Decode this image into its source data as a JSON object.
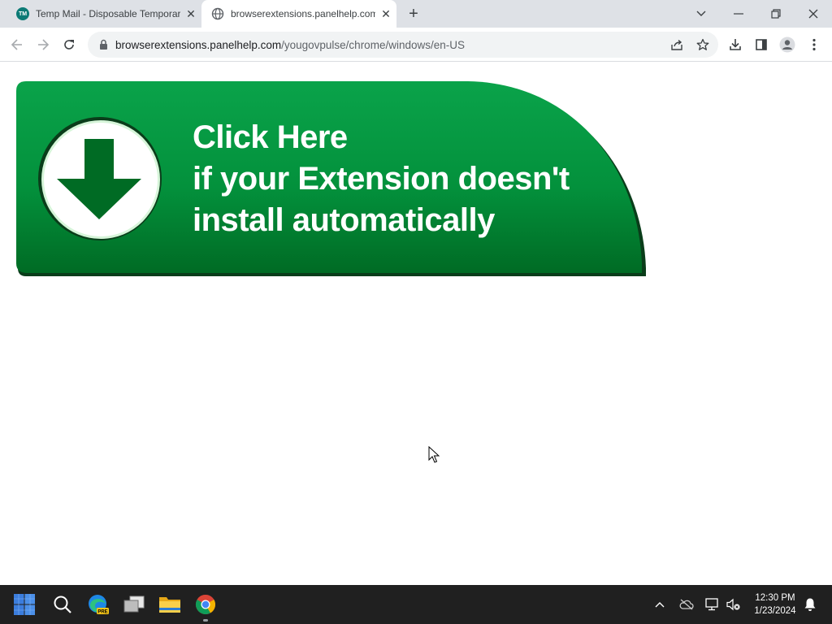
{
  "browser": {
    "tabs": [
      {
        "title": "Temp Mail - Disposable Temporary",
        "favicon": "tempmail-icon",
        "active": false
      },
      {
        "title": "browserextensions.panelhelp.com",
        "favicon": "globe-icon",
        "active": true
      }
    ],
    "address": {
      "host": "browserextensions.panelhelp.com",
      "path": "/yougovpulse/chrome/windows/en-US"
    }
  },
  "page": {
    "banner": {
      "line1": "Click Here",
      "line2": "if your Extension doesn't",
      "line3": "install automatically",
      "colors": {
        "green_top": "#0aa34a",
        "green_bottom": "#006b24",
        "arrow": "#006b24"
      }
    }
  },
  "taskbar": {
    "items": [
      "start-icon",
      "search-icon",
      "edge-beta-icon",
      "task-view-icon",
      "file-explorer-icon",
      "chrome-icon"
    ],
    "edge_badge": "PRE",
    "clock": {
      "time": "12:30 PM",
      "date": "1/23/2024"
    }
  }
}
